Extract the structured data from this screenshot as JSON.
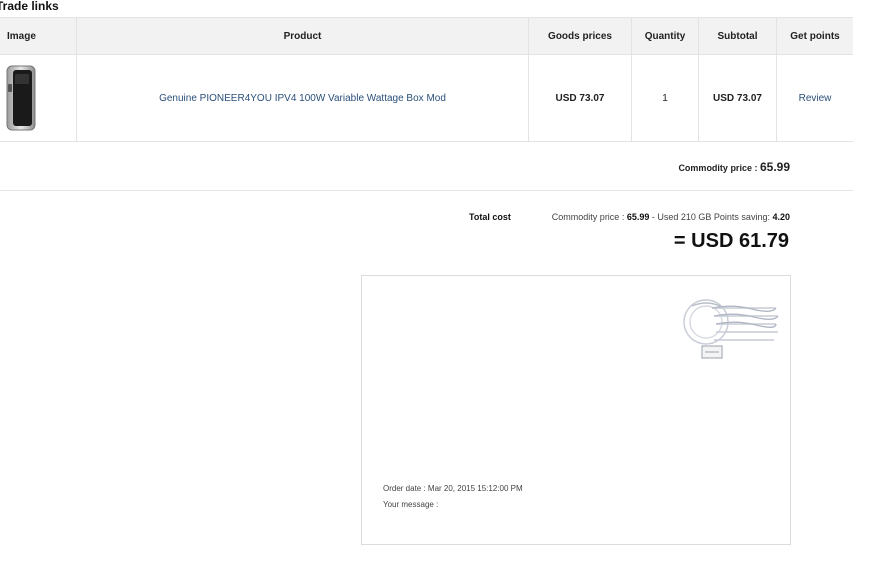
{
  "section": {
    "title": "Trade links"
  },
  "table": {
    "headers": {
      "image": "Image",
      "product": "Product",
      "goods_prices": "Goods prices",
      "quantity": "Quantity",
      "subtotal": "Subtotal",
      "get_points": "Get points"
    },
    "rows": [
      {
        "image_icon": "box-mod-product-image",
        "product": "Genuine PIONEER4YOU IPV4 100W Variable Wattage Box Mod",
        "goods_price": "USD 73.07",
        "quantity": "1",
        "subtotal": "USD 73.07",
        "get_points": "Review"
      }
    ]
  },
  "commodity": {
    "label": "Commodity price :",
    "value": "65.99"
  },
  "total": {
    "label": "Total cost",
    "commodity_label": "Commodity price :",
    "commodity_value": "65.99",
    "points_text": "- Used 210 GB Points saving:",
    "saving_value": "4.20",
    "grand_total": "= USD 61.79"
  },
  "message_box": {
    "stamp_icon": "postmark-stamp-icon",
    "order_date": "Order date : Mar 20, 2015 15:12:00 PM",
    "your_message": "Your message :"
  },
  "colors": {
    "link": "#2b4f7a",
    "header_bg": "#f2f2f2",
    "border": "#e3e3e3"
  }
}
